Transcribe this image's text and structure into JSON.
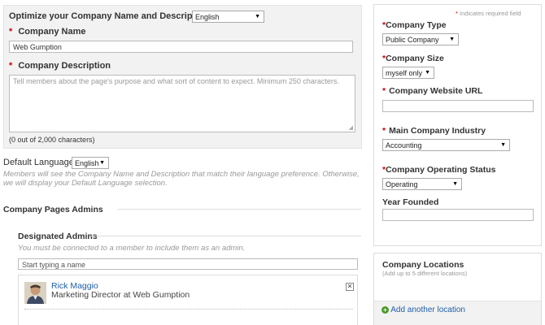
{
  "optimize": {
    "label": "Optimize your Company Name and Description for:",
    "language": "English"
  },
  "company_name": {
    "label": "Company Name",
    "value": "Web Gumption"
  },
  "company_description": {
    "label": "Company Description",
    "placeholder": "Tell members about the page's purpose and what sort of content to expect. Minimum 250 characters.",
    "counter": "(0 out of 2,000 characters)"
  },
  "default_language": {
    "label": "Default Language:",
    "value": "English",
    "help": "Members will see the Company Name and Description that match their language preference. Otherwise, we will display your Default Language selection."
  },
  "admins": {
    "section_title": "Company Pages Admins",
    "designated_title": "Designated Admins",
    "note": "You must be connected to a member to include them as an admin.",
    "search_placeholder": "Start typing a name",
    "admin_name": "Rick Maggio",
    "admin_title": "Marketing Director at Web Gumption"
  },
  "right_panel": {
    "required_note": "Indicates required field",
    "company_type": {
      "label": "Company Type",
      "value": "Public Company"
    },
    "company_size": {
      "label": "Company Size",
      "value": "myself only"
    },
    "website": {
      "label": "Company Website URL",
      "value": ""
    },
    "industry": {
      "label": "Main Company Industry",
      "value": "Accounting"
    },
    "status": {
      "label": "Company Operating Status",
      "value": "Operating"
    },
    "year_founded": {
      "label": "Year Founded",
      "value": ""
    }
  },
  "locations": {
    "title": "Company Locations",
    "subtitle": "(Add up to 5 different locations)",
    "add_label": "Add another location"
  },
  "required_star": "*",
  "colors": {
    "link": "#1f5ea8",
    "required": "#cc0000",
    "panel_bg": "#f2f2f2",
    "add_green": "#4a9a2a"
  }
}
